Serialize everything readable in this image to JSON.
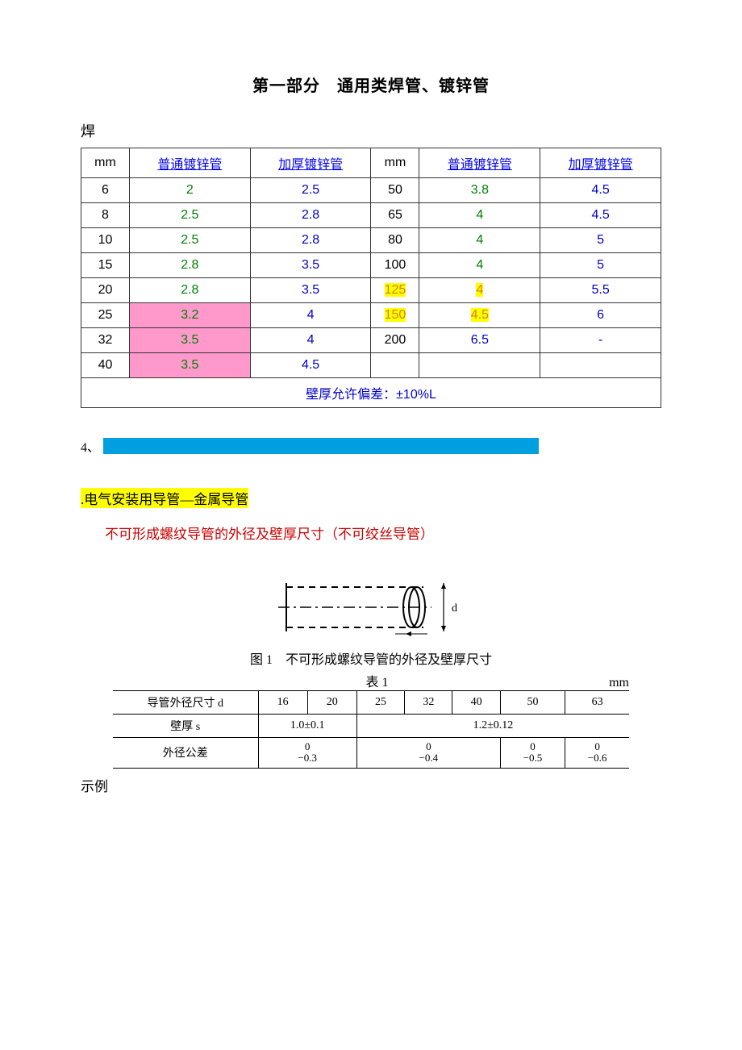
{
  "title": "第一部分　通用类焊管、镀锌管",
  "prefix": "焊",
  "table1": {
    "headers": [
      "mm",
      "普通镀锌管",
      "加厚镀锌管",
      "mm",
      "普通镀锌管",
      "加厚镀锌管"
    ],
    "rows": [
      {
        "c0": "6",
        "c1": "2",
        "c2": "2.5",
        "c3": "50",
        "c4": "3.8",
        "c5": "4.5"
      },
      {
        "c0": "8",
        "c1": "2.5",
        "c2": "2.8",
        "c3": "65",
        "c4": "4",
        "c5": "4.5"
      },
      {
        "c0": "10",
        "c1": "2.5",
        "c2": "2.8",
        "c3": "80",
        "c4": "4",
        "c5": "5"
      },
      {
        "c0": "15",
        "c1": "2.8",
        "c2": "3.5",
        "c3": "100",
        "c4": "4",
        "c5": "5"
      },
      {
        "c0": "20",
        "c1": "2.8",
        "c2": "3.5",
        "c3": "125",
        "c4": "4",
        "c5": "5.5"
      },
      {
        "c0": "25",
        "c1": "3.2",
        "c2": "4",
        "c3": "150",
        "c4": "4.5",
        "c5": "6"
      },
      {
        "c0": "32",
        "c1": "3.5",
        "c2": "4",
        "c3": "200",
        "c4": "6.5",
        "c5": "-"
      },
      {
        "c0": "40",
        "c1": "3.5",
        "c2": "4.5",
        "c3": "",
        "c4": "",
        "c5": ""
      }
    ],
    "footer": "壁厚允许偏差：±10%L"
  },
  "section4_label": "4、",
  "subtitle": ".电气安装用导管—金属导管",
  "red_subtitle": "不可形成螺纹导管的外径及壁厚尺寸（不可绞丝导管）",
  "figure": {
    "caption": "图 1　不可形成螺纹导管的外径及壁厚尺寸",
    "dlabel": "d"
  },
  "table2": {
    "caption": "表 1",
    "unit": "mm",
    "row_d_label": "导管外径尺寸 d",
    "row_d_vals": [
      "16",
      "20",
      "25",
      "32",
      "40",
      "50",
      "63"
    ],
    "row_s_label": "壁厚 s",
    "row_s_vals": [
      "1.0±0.1",
      "1.2±0.12"
    ],
    "row_tol_label": "外径公差",
    "row_tol_vals": [
      {
        "top": "0",
        "bot": "−0.3"
      },
      {
        "top": "0",
        "bot": "−0.4"
      },
      {
        "top": "0",
        "bot": "−0.5"
      },
      {
        "top": "0",
        "bot": "−0.6"
      }
    ]
  },
  "example_label": "示例"
}
